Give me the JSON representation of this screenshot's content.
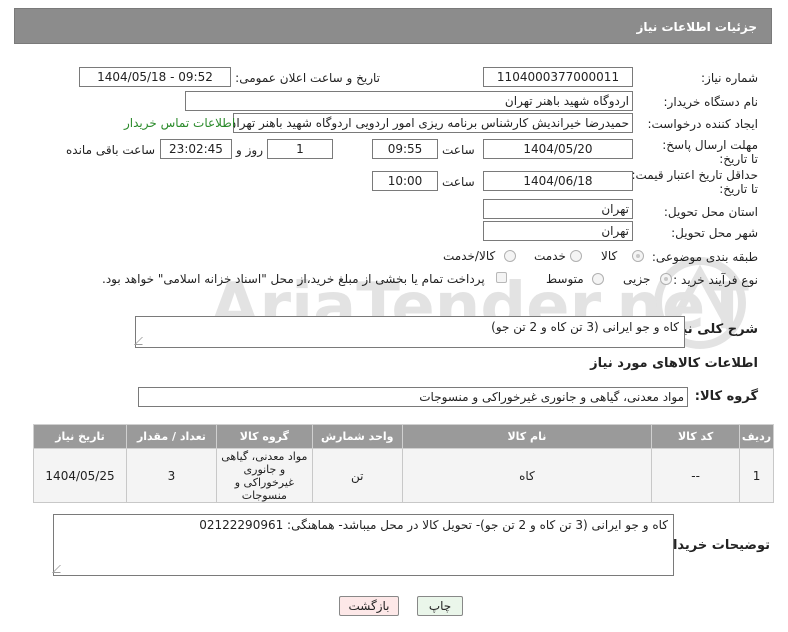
{
  "header": {
    "title": "جزئیات اطلاعات نیاز"
  },
  "form": {
    "need_number": {
      "label": "شماره نیاز:",
      "value": "1104000377000011"
    },
    "announce": {
      "label": "تاریخ و ساعت اعلان عمومی:",
      "value": "1404/05/18 - 09:52"
    },
    "buyer_org": {
      "label": "نام دستگاه خریدار:",
      "value": "اردوگاه شهید باهنر تهران"
    },
    "requester": {
      "label": "ایجاد کننده درخواست:",
      "value": "حمیدرضا خیراندیش کارشناس برنامه ریزی امور اردویی اردوگاه شهید باهنر تهران",
      "contact_link": "اطلاعات تماس خریدار"
    },
    "deadline": {
      "label": "مهلت ارسال پاسخ: تا تاریخ:",
      "date": "1404/05/20",
      "time_label": "ساعت",
      "time": "09:55",
      "days": "1",
      "days_label": "روز و",
      "remaining": "23:02:45",
      "remaining_label": "ساعت باقی مانده"
    },
    "price_validity": {
      "label": "حداقل تاریخ اعتبار قیمت: تا تاریخ:",
      "date": "1404/06/18",
      "time_label": "ساعت",
      "time": "10:00"
    },
    "province": {
      "label": "استان محل تحویل:",
      "value": "تهران"
    },
    "city": {
      "label": "شهر محل تحویل:",
      "value": "تهران"
    },
    "category": {
      "label": "طبقه بندی موضوعی:",
      "options": [
        "کالا",
        "خدمت",
        "کالا/خدمت"
      ],
      "selected": "کالا"
    },
    "process": {
      "label": "نوع فرآیند خرید :",
      "options": [
        "جزیی",
        "متوسط"
      ],
      "selected": "جزیی",
      "payment_note": "پرداخت تمام یا بخشی از مبلغ خرید،از محل \"اسناد خزانه اسلامی\" خواهد بود."
    },
    "summary": {
      "label": "شرح کلی نیاز:",
      "value": "کاه و جو ایرانی (3 تن کاه و 2 تن جو)"
    },
    "goods_info_title": "اطلاعات کالاهای مورد نیاز",
    "goods_group": {
      "label": "گروه کالا:",
      "value": "مواد معدنی، گیاهی و جانوری غیرخوراکی و منسوجات"
    }
  },
  "table": {
    "headers": [
      "ردیف",
      "کد کالا",
      "نام کالا",
      "واحد شمارش",
      "گروه کالا",
      "تعداد / مقدار",
      "تاریخ نیاز"
    ],
    "rows": [
      {
        "row": "1",
        "code": "--",
        "name": "کاه",
        "unit": "تن",
        "group": "مواد معدنی، گیاهی و جانوری غیرخوراکی و منسوجات",
        "qty": "3",
        "date": "1404/05/25"
      }
    ]
  },
  "buyer_notes": {
    "label": "توضیحات خریدار:",
    "value": "کاه و جو ایرانی (3 تن کاه و 2 تن جو)- تحویل کالا در محل میباشد- هماهنگی: 02122290961"
  },
  "buttons": {
    "print": "چاپ",
    "back": "بازگشت"
  },
  "watermark": {
    "text": "AriaTender.neT"
  },
  "colors": {
    "header_bg": "#8c8c8c",
    "link": "#2a8a2a",
    "back_button_bg": "#fde8e8",
    "print_button_bg": "#eaf6ea"
  }
}
